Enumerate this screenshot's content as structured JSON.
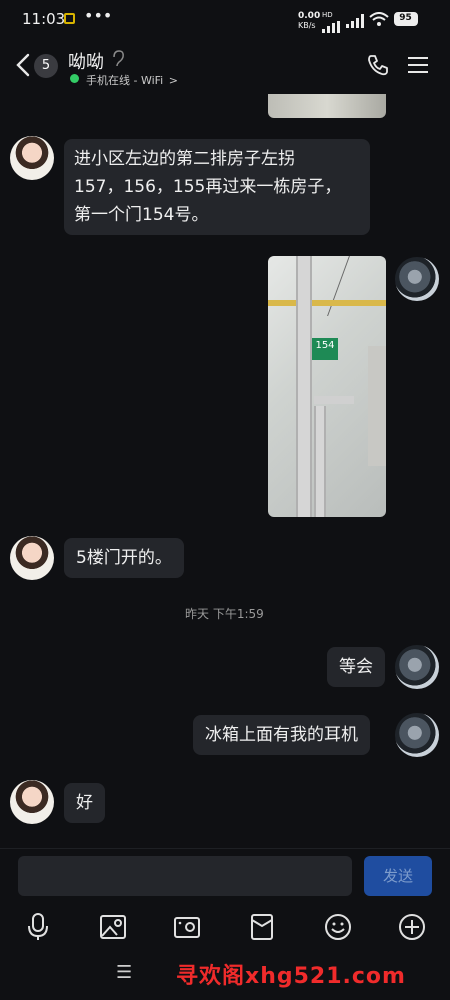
{
  "status_bar": {
    "time": "11:03",
    "speed_value": "0.00",
    "speed_unit": "KB/s",
    "battery": "95",
    "hd_label": "HD"
  },
  "header": {
    "unread_count": "5",
    "contact_name": "呦呦",
    "online_status": "手机在线 - WiFi",
    "online_chevron": ">"
  },
  "messages": {
    "m1_text_line1": "进小区左边的第二排房子左拐",
    "m1_text_line2": "157，156，155再过来一栋房子，",
    "m1_text_line3": "第一个门154号。",
    "photo_sign_text": "154",
    "m3_text": "5楼门开的。",
    "timestamp": "昨天 下午1:59",
    "m4_text": "等会",
    "m5_text": "冰箱上面有我的耳机",
    "m6_text": "好"
  },
  "composer": {
    "send_label": "发送",
    "input_value": ""
  },
  "toolbar": {
    "icons": [
      "mic-icon",
      "image-icon",
      "camera-icon",
      "red-packet-icon",
      "emoji-icon",
      "plus-icon"
    ]
  },
  "navbar": {
    "menu_glyph": "☰"
  },
  "watermark": "寻欢阁xhg521.com",
  "colors": {
    "background": "#0f1013",
    "bubble": "#24262b",
    "send_button": "#1f4da0",
    "online_dot": "#33cc66",
    "watermark": "#f02b2b"
  }
}
